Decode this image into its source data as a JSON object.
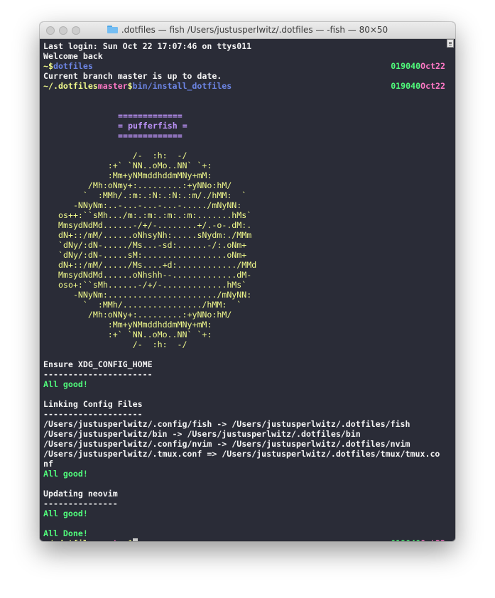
{
  "window": {
    "title": ".dotfiles — fish  /Users/justusperlwitz/.dotfiles — -fish — 80×50",
    "folder_icon": "folder-icon"
  },
  "terminal": {
    "last_login": "Last login: Sun Oct 22 17:07:46 on ttys011",
    "welcome": "Welcome back",
    "prompt1": {
      "tilde": "~$",
      "cmd": "dotfiles"
    },
    "branch_msg": "Current branch master is up to date.",
    "prompt2": {
      "path": "~/.dotfiles",
      "branch": "master",
      "dollar": "$",
      "cmd": "bin/install_dotfiles"
    },
    "right_prompt": {
      "time": "019040",
      "date": "Oct22"
    },
    "banner": {
      "rule": "=============",
      "title": "= pufferfish ="
    },
    "ascii_art": [
      "               /-  :h:  -/",
      "          :+` `NN..oMo..NN` `+:",
      "          :Mm+yNMmddhddmMNy+mM:",
      "      /Mh:oNmy+:.........:+yNNo:hM/",
      "     `  :MMh/.:m:.:N:.:N:.:m/./hMM:  `",
      "   -NNyNm:..-...-...-...-...../mNyNN:",
      "os++:``sMh.../m:.:m:.:m:.:m:.......hMs`",
      "MmsydNdMd......-/+/-........+/.-o-.dM:.",
      "dN+::/mM/......oNhsyNh:.....sNydm:./MMm",
      "`dNy/:dN-...../Ms...-sd:......-/:.oNm+",
      "`dNy/:dN-.....sM:.................oNm+",
      "dN+::/mM/...../Ms....+d:............/MMd",
      "MmsydNdMd......oNhshh--.............dM-",
      "oso+:``sMh......-/+/-.............hMs`",
      "   -NNyNm:....................../mNyNN:",
      "     `  :MMh/................/hMM:  `",
      "      /Mh:oNNy+:.........:+yNNo:hM/",
      "          :Mm+yNMmddhddmMNy+mM:",
      "          :+` `NN..oMo..NN` `+:",
      "               /-  :h:  -/"
    ],
    "xdg_header": "Ensure XDG_CONFIG_HOME",
    "xdg_rule": "----------------------",
    "all_good": "All good!",
    "link_header": "Linking Config Files",
    "link_rule": "--------------------",
    "link_lines": [
      "/Users/justusperlwitz/.config/fish -> /Users/justusperlwitz/.dotfiles/fish",
      "/Users/justusperlwitz/bin -> /Users/justusperlwitz/.dotfiles/bin",
      "/Users/justusperlwitz/.config/nvim -> /Users/justusperlwitz/.dotfiles/nvim",
      "/Users/justusperlwitz/.tmux.conf => /Users/justusperlwitz/.dotfiles/tmux/tmux.co",
      "nf"
    ],
    "neovim_header": "Updating neovim",
    "neovim_rule": "---------------",
    "all_done": "All Done!"
  },
  "colors": {
    "background": "#2a2c37",
    "text": "#f4f4f4",
    "yellow": "#f1fa8c",
    "pink": "#ff79c6",
    "green": "#50fa7b",
    "blue": "#6d86e6",
    "purple": "#bd93f9"
  }
}
